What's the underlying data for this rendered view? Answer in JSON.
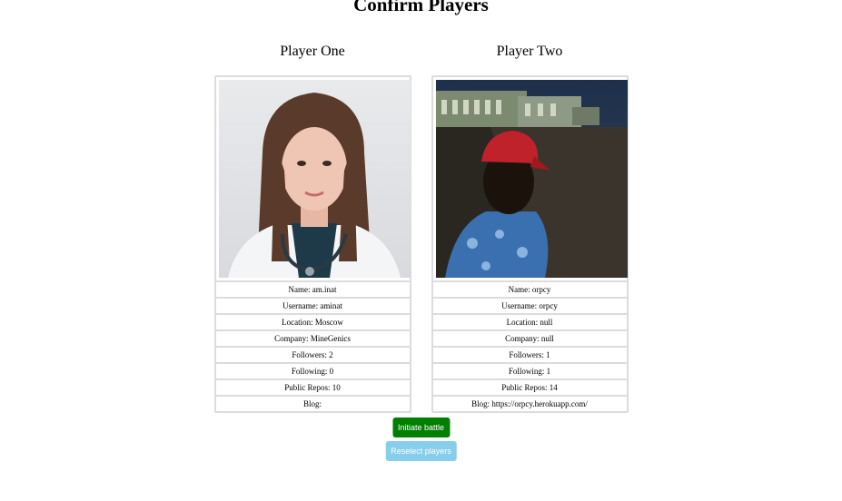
{
  "page": {
    "title": "Confirm Players"
  },
  "players": [
    {
      "heading": "Player One",
      "avatar_desc": "portrait of a woman in a white doctor's coat with a stethoscope",
      "rows": [
        "Name: am.inat",
        "Username: aminat",
        "Location: Moscow",
        "Company: MineGenics",
        "Followers: 2",
        "Following: 0",
        "Public Repos: 10",
        "Blog:"
      ]
    },
    {
      "heading": "Player Two",
      "avatar_desc": "dark selfie of a man in a red cap in front of buildings",
      "rows": [
        "Name: orpcy",
        "Username: orpcy",
        "Location: null",
        "Company: null",
        "Followers: 1",
        "Following: 1",
        "Public Repos: 14",
        "Blog: https://orpcy.herokuapp.com/"
      ]
    }
  ],
  "actions": {
    "initiate_label": "Initiate battle",
    "reselect_label": "Reselect players"
  },
  "colors": {
    "initiate_bg": "#008000",
    "reselect_bg": "#87ceeb",
    "card_border": "#dcdcdc"
  }
}
